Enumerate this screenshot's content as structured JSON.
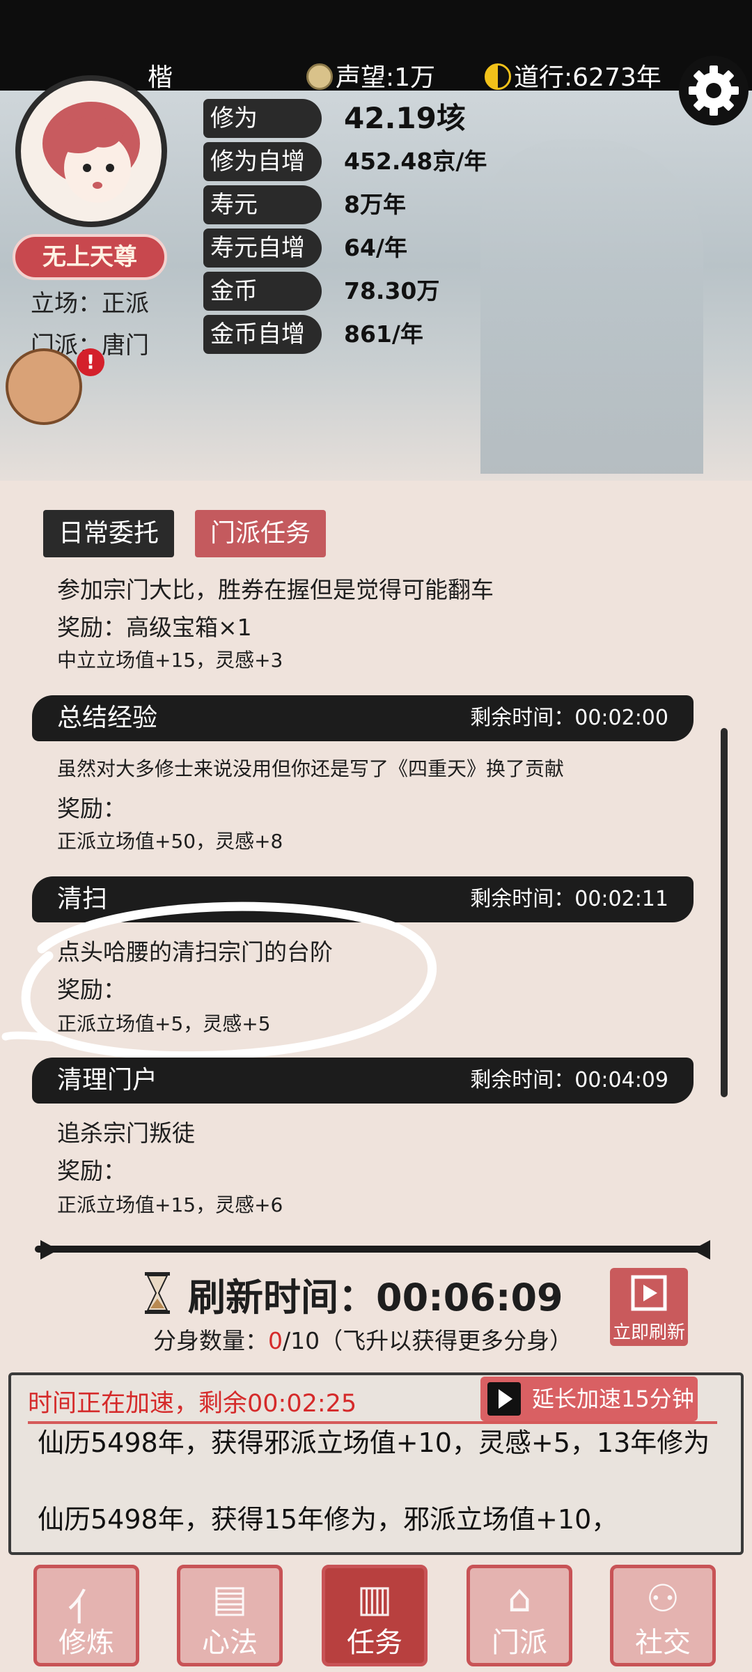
{
  "top": {
    "player_name": "楷",
    "prestige": "声望:1万",
    "daoxing": "道行:6273年"
  },
  "profile": {
    "title_badge": "无上天尊",
    "stance": "立场：正派",
    "sect": "门派：唐门"
  },
  "stats": [
    {
      "label": "修为",
      "value": "42.19垓"
    },
    {
      "label": "修为自增",
      "value": "452.48京/年"
    },
    {
      "label": "寿元",
      "value": "8万年"
    },
    {
      "label": "寿元自增",
      "value": "64/年"
    },
    {
      "label": "金币",
      "value": "78.30万"
    },
    {
      "label": "金币自增",
      "value": "861/年"
    }
  ],
  "tabs": {
    "daily": "日常委托",
    "sect": "门派任务"
  },
  "first_task": {
    "desc": "参加宗门大比，胜券在握但是觉得可能翻车",
    "reward": "奖励：高级宝箱×1",
    "bonus": "中立立场值+15，灵感+3"
  },
  "tasks": [
    {
      "name": "总结经验",
      "time": "剩余时间：00:02:00",
      "desc": "虽然对大多修士来说没用但你还是写了《四重天》换了贡献",
      "reward": "奖励：",
      "bonus": "正派立场值+50，灵感+8"
    },
    {
      "name": "清扫",
      "time": "剩余时间：00:02:11",
      "desc": "点头哈腰的清扫宗门的台阶",
      "reward": "奖励：",
      "bonus": "正派立场值+5，灵感+5"
    },
    {
      "name": "清理门户",
      "time": "剩余时间：00:04:09",
      "desc": "追杀宗门叛徒",
      "reward": "奖励：",
      "bonus": "正派立场值+15，灵感+6"
    }
  ],
  "refresh": {
    "label": "刷新时间：00:06:09",
    "clone_prefix": "分身数量：",
    "clone_count": "0",
    "clone_suffix": "/10（飞升以获得更多分身）",
    "instant_button": "立即刷新"
  },
  "log_panel": {
    "speedup": "时间正在加速，剩余00:02:25",
    "extend_button": "延长加速15分钟",
    "entries": [
      "仙历5498年，获得邪派立场值+10，灵感+5，13年修为",
      "仙历5498年，获得15年修为，邪派立场值+10，"
    ]
  },
  "nav": [
    {
      "label": "修炼",
      "icon": "cultivate-icon",
      "active": false
    },
    {
      "label": "心法",
      "icon": "scroll-icon",
      "active": false
    },
    {
      "label": "任务",
      "icon": "task-icon",
      "active": true
    },
    {
      "label": "门派",
      "icon": "sect-icon",
      "active": false
    },
    {
      "label": "社交",
      "icon": "social-icon",
      "active": false
    }
  ],
  "colors": {
    "accent_red": "#c95a5c",
    "warning_red": "#d52a2a",
    "ink": "#1c1c1c",
    "paper": "#efe3dc"
  }
}
